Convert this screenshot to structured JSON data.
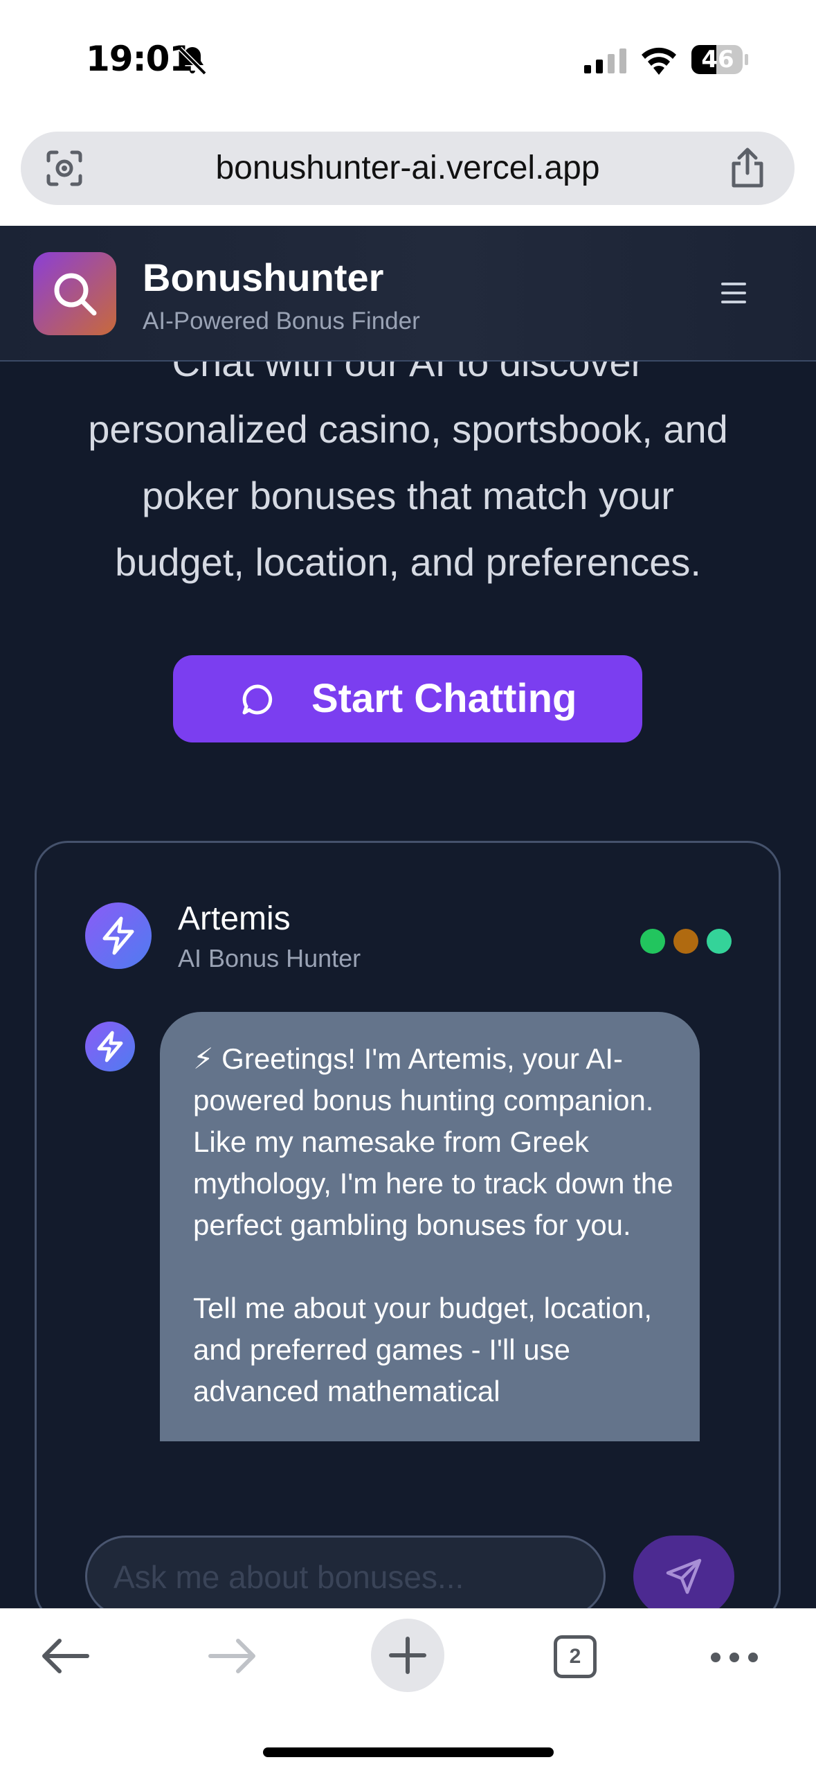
{
  "status_bar": {
    "time": "19:01",
    "battery": "46"
  },
  "browser": {
    "url": "bonushunter-ai.vercel.app",
    "tab_count": "2"
  },
  "site": {
    "brand_name": "Bonushunter",
    "tagline": "AI-Powered Bonus Finder"
  },
  "hero": {
    "text": "Chat with our AI to discover\npersonalized casino, sportsbook, and\npoker bonuses that match your\nbudget, location, and preferences.",
    "cta_label": "Start Chatting"
  },
  "chat": {
    "agent_name": "Artemis",
    "agent_role": "AI Bonus Hunter",
    "status_colors": [
      "#22c55e",
      "#b06a10",
      "#34d399"
    ],
    "message": "⚡ Greetings! I'm Artemis, your AI-powered bonus hunting companion. Like my namesake from Greek mythology, I'm here to track down the perfect gambling bonuses for you.\n\nTell me about your budget, location, and preferred games - I'll use advanced mathematical",
    "input_placeholder": "Ask me about bonuses..."
  },
  "colors": {
    "page_bg": "#121a2b",
    "accent": "#7b3ef0",
    "bubble": "#64748b"
  }
}
